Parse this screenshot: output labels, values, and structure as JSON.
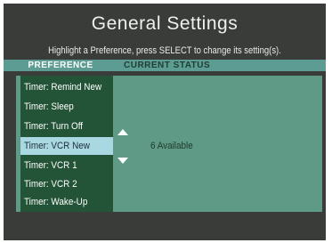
{
  "screen": {
    "title": "General Settings",
    "instruction": "Highlight a Preference, press SELECT to change its setting(s)."
  },
  "columns": {
    "preference": "PREFERENCE",
    "current_status": "CURRENT STATUS"
  },
  "preferences": [
    {
      "label": "Timer: Remind New"
    },
    {
      "label": "Timer: Sleep"
    },
    {
      "label": "Timer: Turn Off"
    },
    {
      "label": "Timer: VCR New",
      "selected": true
    },
    {
      "label": "Timer: VCR 1"
    },
    {
      "label": "Timer: VCR 2"
    },
    {
      "label": "Timer: Wake-Up"
    }
  ],
  "current_status": {
    "value": "6 Available"
  },
  "icons": {
    "scroll_up": "triangle-up-icon",
    "scroll_down": "triangle-down-icon"
  },
  "colors": {
    "background": "#3a3c3a",
    "header_bar": "#5c9c92",
    "list_background": "#245437",
    "status_panel": "#5e9a86",
    "selection": "#a9d8e3"
  }
}
